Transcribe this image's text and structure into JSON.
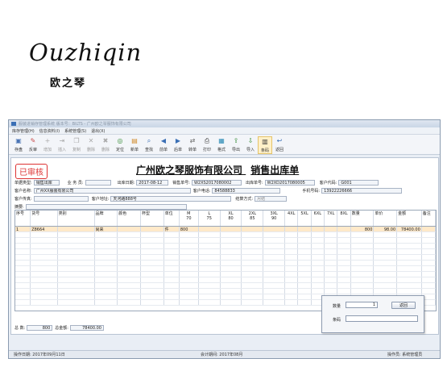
{
  "brand": {
    "script_name": "Ouzhiqin",
    "chinese_name": "欧之琴"
  },
  "window": {
    "title": "服装进销存管理系统 版本号：BILTS - 广州欧之琴服饰有限公司"
  },
  "menu": [
    "库存管理(H)",
    "信息资料(I)",
    "系统管理(S)",
    "退出(X)"
  ],
  "toolbar": [
    {
      "label": "存盘",
      "icon": "save-icon",
      "disabled": false
    },
    {
      "label": "反审",
      "icon": "unapprove-icon",
      "disabled": false
    },
    {
      "label": "增加",
      "icon": "add-icon",
      "disabled": true
    },
    {
      "label": "插入",
      "icon": "insert-icon",
      "disabled": true
    },
    {
      "label": "复制",
      "icon": "copy-icon",
      "disabled": true
    },
    {
      "label": "删除",
      "icon": "delete-icon",
      "disabled": true
    },
    {
      "label": "删除",
      "icon": "delete-row-icon",
      "disabled": true
    },
    {
      "label": "定位",
      "icon": "locate-icon",
      "disabled": false
    },
    {
      "label": "新单",
      "icon": "new-doc-icon",
      "disabled": false
    },
    {
      "label": "查找",
      "icon": "find-icon",
      "disabled": false
    },
    {
      "label": "前单",
      "icon": "prev-doc-icon",
      "disabled": false
    },
    {
      "label": "后单",
      "icon": "next-doc-icon",
      "disabled": false
    },
    {
      "label": "转单",
      "icon": "transfer-icon",
      "disabled": false
    },
    {
      "label": "打印",
      "icon": "print-icon",
      "disabled": false
    },
    {
      "label": "格式",
      "icon": "format-icon",
      "disabled": false
    },
    {
      "label": "导出",
      "icon": "export-icon",
      "disabled": false
    },
    {
      "label": "导入",
      "icon": "import-icon",
      "disabled": false
    },
    {
      "label": "条码",
      "icon": "barcode-icon",
      "disabled": false
    },
    {
      "label": "返回",
      "icon": "return-icon",
      "disabled": false
    }
  ],
  "doc": {
    "stamp": "已审核",
    "company_title": "广州欧之琴服饰有限公司",
    "doc_title": "销售出库单",
    "row1": {
      "type_label": "单据类型:",
      "type_value": "销售出库",
      "clerk_label": "业 务 员:",
      "clerk_value": "",
      "date_label": "出库日期:",
      "date_value": "2017-08-12",
      "sales_no_label": "销售单号:",
      "sales_no_value": "W2XS2017080002",
      "out_no_label": "出库单号:",
      "out_no_value": "W2XD2017080005",
      "cust_code_label": "客户代码:",
      "cust_code_value": "G001"
    },
    "row2": {
      "cust_name_label": "客户名称:",
      "cust_name_value": "广州XX服装有限公司",
      "phone_label": "客户电话:",
      "phone_value": "84588833",
      "mobile_label": "手机号码:",
      "mobile_value": "13922226666"
    },
    "row3": {
      "contact_label": "客户传真:",
      "contact_value": "",
      "addr_label": "客户地址:",
      "addr_value": "天河路888号",
      "settle_label": "结算方式:",
      "settle_value": "月结"
    },
    "row4": {
      "memo_label": "摘要:",
      "memo_value": ""
    }
  },
  "grid": {
    "columns": [
      "序号",
      "货号",
      "类别",
      "品牌",
      "颜色",
      "杯型",
      "单位",
      "M\n70",
      "L\n75",
      "XL\n80",
      "2XL\n85",
      "3XL\n90",
      "4XL",
      "5XL",
      "6XL",
      "7XL",
      "8XL",
      "数量",
      "单价",
      "金额",
      "备注"
    ],
    "rows": [
      [
        "1",
        "Z8664",
        "",
        "尚来",
        "",
        "",
        "件",
        "800",
        "",
        "",
        "",
        "",
        "",
        "",
        "",
        "",
        "",
        "800",
        "98.00",
        "78400.00",
        ""
      ]
    ]
  },
  "totals": {
    "qty_label": "总 数:",
    "qty_value": "800",
    "amount_label": "总金额:",
    "amount_value": "78400.00"
  },
  "status": {
    "op_date": "操作日期: 2017年09月11日",
    "period": "会计期间: 2017年08月",
    "operator": "操作员: 系统管理员"
  },
  "popup": {
    "qty_label": "数量",
    "qty_value": "1",
    "barcode_label": "条码",
    "barcode_value": "",
    "ok_label": "返回"
  }
}
